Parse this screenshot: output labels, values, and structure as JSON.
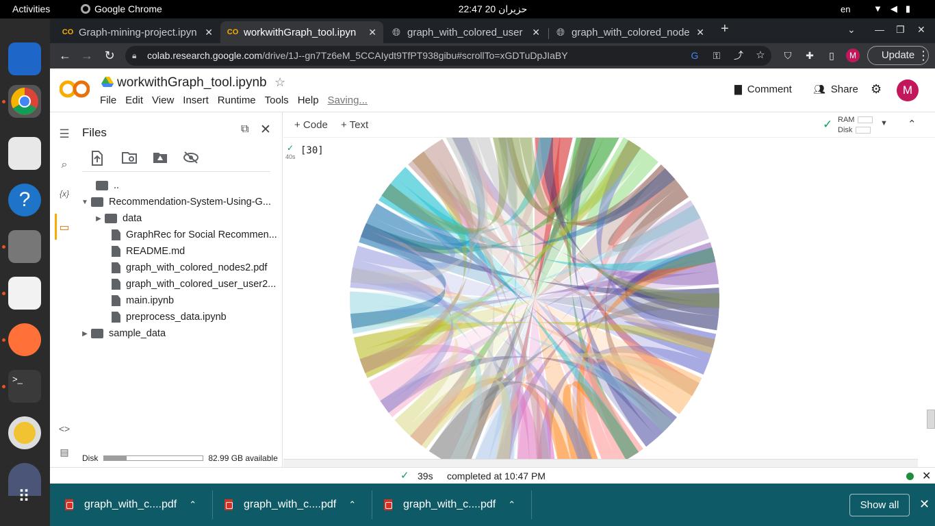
{
  "os": {
    "activities": "Activities",
    "app_name": "Google Chrome",
    "clock": "22:47  20 حزيران",
    "lang": "en"
  },
  "browser": {
    "tabs": [
      {
        "title": "Graph-mining-project.ipyn",
        "active": false
      },
      {
        "title": "workwithGraph_tool.ipyn",
        "active": true
      },
      {
        "title": "graph_with_colored_user",
        "active": false
      },
      {
        "title": "graph_with_colored_node",
        "active": false
      }
    ],
    "url_host": "colab.research.google.com",
    "url_path": "/drive/1J--gn7Tz6eM_5CCAIydt9TfPT938gibu#scrollTo=xGDTuDpJIaBY",
    "update_label": "Update",
    "profile_initial": "M"
  },
  "colab": {
    "notebook_title": "workwithGraph_tool.ipynb",
    "menu": [
      "File",
      "Edit",
      "View",
      "Insert",
      "Runtime",
      "Tools",
      "Help"
    ],
    "saving": "Saving...",
    "comment_label": "Comment",
    "share_label": "Share",
    "user_initial": "M"
  },
  "files_panel": {
    "title": "Files",
    "tree": [
      {
        "label": "..",
        "type": "up",
        "depth": 0
      },
      {
        "label": "Recommendation-System-Using-G...",
        "type": "folder",
        "depth": 0,
        "expanded": true
      },
      {
        "label": "data",
        "type": "folder",
        "depth": 1,
        "expanded": false
      },
      {
        "label": "GraphRec for Social Recommen...",
        "type": "file",
        "depth": 1
      },
      {
        "label": "README.md",
        "type": "file",
        "depth": 1
      },
      {
        "label": "graph_with_colored_nodes2.pdf",
        "type": "file",
        "depth": 1
      },
      {
        "label": "graph_with_colored_user_user2...",
        "type": "file",
        "depth": 1
      },
      {
        "label": "main.ipynb",
        "type": "file",
        "depth": 1
      },
      {
        "label": "preprocess_data.ipynb",
        "type": "file",
        "depth": 1
      },
      {
        "label": "sample_data",
        "type": "folder",
        "depth": 0,
        "expanded": false
      }
    ],
    "disk_label": "Disk",
    "disk_used_fraction": 0.23,
    "disk_available": "82.99 GB available"
  },
  "notebook": {
    "add_code": "+ Code",
    "add_text": "+ Text",
    "ram_label": "RAM",
    "disk_label": "Disk",
    "cell_exec_count": "[30]",
    "cell_exec_time": "40s"
  },
  "status": {
    "duration": "39s",
    "message": "completed at 10:47 PM"
  },
  "downloads": {
    "items": [
      "graph_with_c....pdf",
      "graph_with_c....pdf",
      "graph_with_c....pdf"
    ],
    "show_all": "Show all"
  },
  "colors": {
    "chord": [
      "#d62728",
      "#2ca02c",
      "#98df8a",
      "#8c564b",
      "#c5b0d5",
      "#9467bd",
      "#393b79",
      "#6b6ecf",
      "#ffbb78",
      "#5254a3",
      "#ff9896",
      "#ff7f0e",
      "#e377c2",
      "#aec7e8",
      "#7f7f7f",
      "#dbdb8d",
      "#f7b6d2",
      "#bcbd22",
      "#9edae5",
      "#9c9ede",
      "#1f77b4",
      "#17becf",
      "#c49c94",
      "#c7c7c7",
      "#8ca252"
    ]
  }
}
